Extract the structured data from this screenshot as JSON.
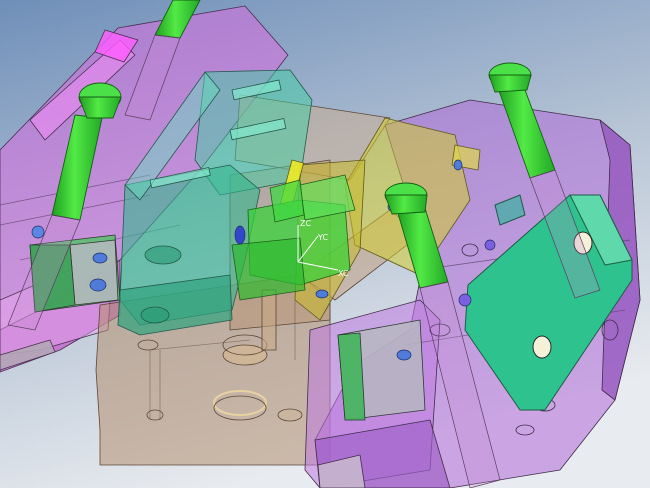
{
  "viewport": {
    "background_top": "#6f8fb9",
    "background_bottom": "#e7eaee"
  },
  "triad": {
    "labels": {
      "zc": "ZC",
      "yc": "YC",
      "xc": "XC"
    }
  },
  "colors": {
    "plate_pink": "#d86ce0",
    "plate_violet": "#b16ad8",
    "core_tan": "#b58f6f",
    "slide_teal": "#3fd0a2",
    "slide_yellow": "#d3cc30",
    "ejector_green": "#39d23a",
    "insert_green": "#45c77a",
    "pin_blue": "#4f7bd9",
    "edge": "#3a3340"
  }
}
